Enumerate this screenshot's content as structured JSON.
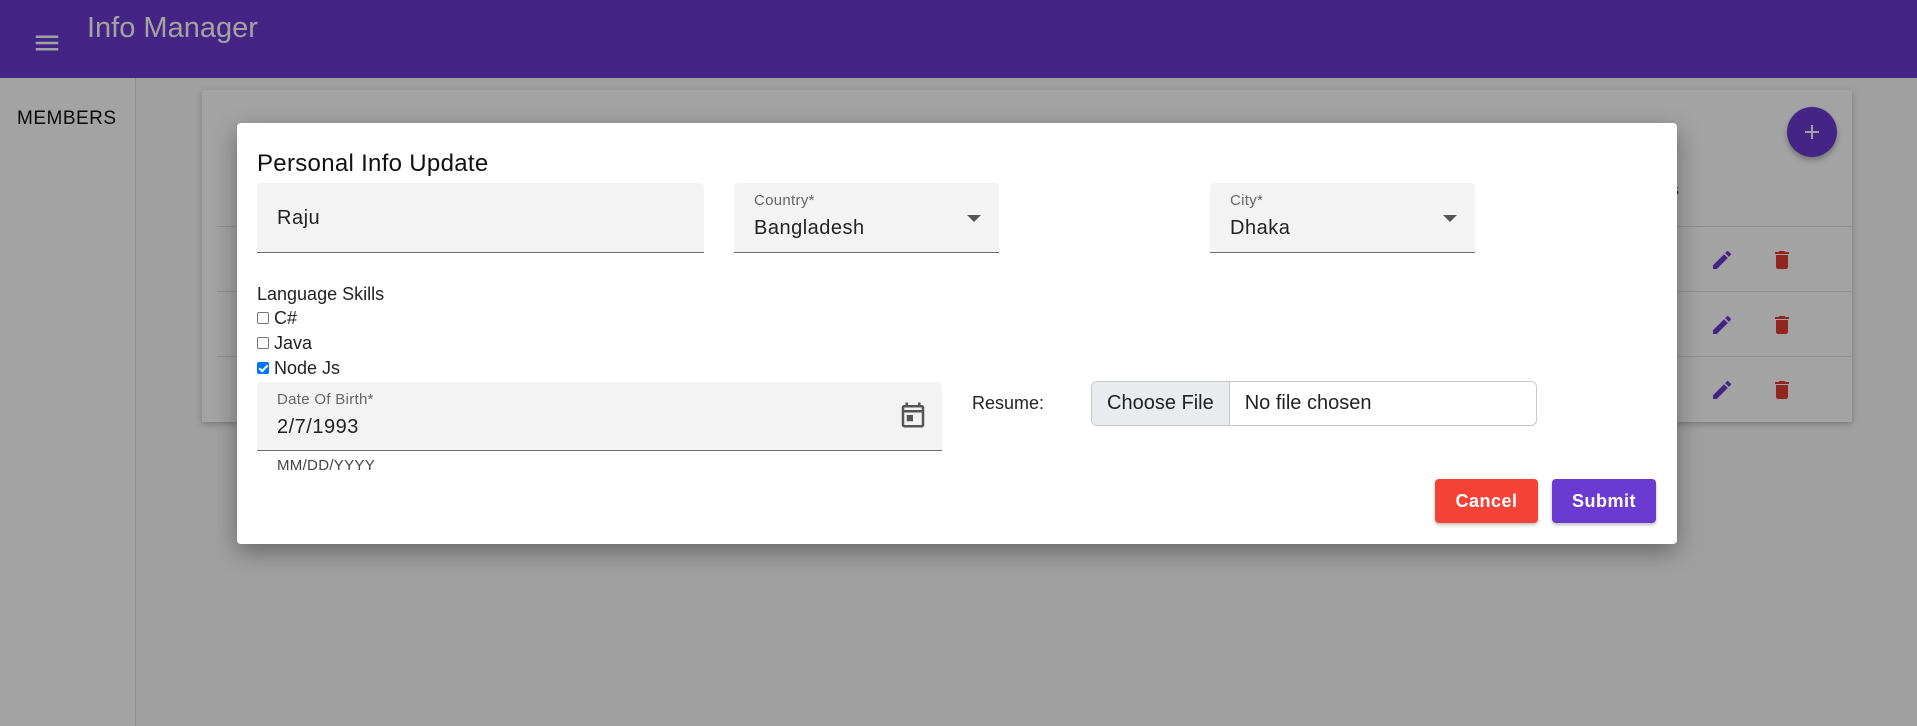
{
  "app": {
    "title": "Info Manager",
    "menu_icon": "menu-icon"
  },
  "sidebar": {
    "items": [
      {
        "label": "MEMBERS"
      }
    ]
  },
  "table": {
    "partial_header": "ns",
    "rows": [
      {
        "edit_icon": "edit-icon",
        "delete_icon": "delete-icon"
      },
      {
        "edit_icon": "edit-icon",
        "delete_icon": "delete-icon"
      },
      {
        "edit_icon": "edit-icon",
        "delete_icon": "delete-icon"
      }
    ],
    "add_button_icon": "plus-icon"
  },
  "dialog": {
    "title": "Personal Info Update",
    "name": {
      "value": "Raju"
    },
    "country": {
      "label": "Country*",
      "value": "Bangladesh"
    },
    "city": {
      "label": "City*",
      "value": "Dhaka"
    },
    "language_skills": {
      "label": "Language Skills",
      "options": [
        {
          "label": "C#",
          "checked": false
        },
        {
          "label": "Java",
          "checked": false
        },
        {
          "label": "Node Js",
          "checked": true
        }
      ]
    },
    "date_of_birth": {
      "label": "Date Of Birth*",
      "value": "2/7/1993",
      "helper": "MM/DD/YYYY",
      "icon": "calendar-icon"
    },
    "resume": {
      "label": "Resume:",
      "button_label": "Choose File",
      "status": "No file chosen"
    },
    "cancel_label": "Cancel",
    "submit_label": "Submit"
  },
  "colors": {
    "primary": "#6b3ad1",
    "danger": "#f44336",
    "checkbox": "#0075ff"
  }
}
